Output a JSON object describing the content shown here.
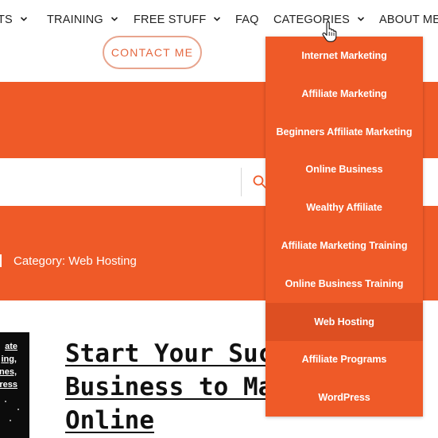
{
  "nav": {
    "items": [
      {
        "label": "TS",
        "has_dropdown": true
      },
      {
        "label": "TRAINING",
        "has_dropdown": true
      },
      {
        "label": "FREE STUFF",
        "has_dropdown": true
      },
      {
        "label": "FAQ",
        "has_dropdown": false
      },
      {
        "label": "CATEGORIES",
        "has_dropdown": true,
        "active": true
      },
      {
        "label": "ABOUT ME",
        "has_dropdown": false
      }
    ],
    "contact_label": "CONTACT ME"
  },
  "search": {
    "value": "",
    "placeholder": ""
  },
  "breadcrumb": {
    "text": "Category: Web Hosting"
  },
  "thumbnail": {
    "lines": [
      "ate",
      "ing,",
      "nes,",
      "ress"
    ]
  },
  "post": {
    "title_lines": [
      "Start Your Succ",
      "Business to Ma",
      "Online"
    ]
  },
  "categories_menu": {
    "items": [
      "Internet Marketing",
      "Affiliate Marketing",
      "Beginners Affiliate Marketing",
      "Online Business",
      "Wealthy Affiliate",
      "Affiliate Marketing Training",
      "Online Business Training",
      "Web Hosting",
      "Affiliate Programs",
      "WordPress"
    ],
    "hovered_item": "Web Hosting"
  },
  "colors": {
    "brand_orange": "#ef5a28",
    "menu_hover": "#dd4f22",
    "contact_border": "#e8a58e",
    "text_dark": "#222222"
  },
  "icons": {
    "dropdown": "chevron-down-icon",
    "search": "search-icon",
    "cursor": "hand-pointer-icon"
  }
}
